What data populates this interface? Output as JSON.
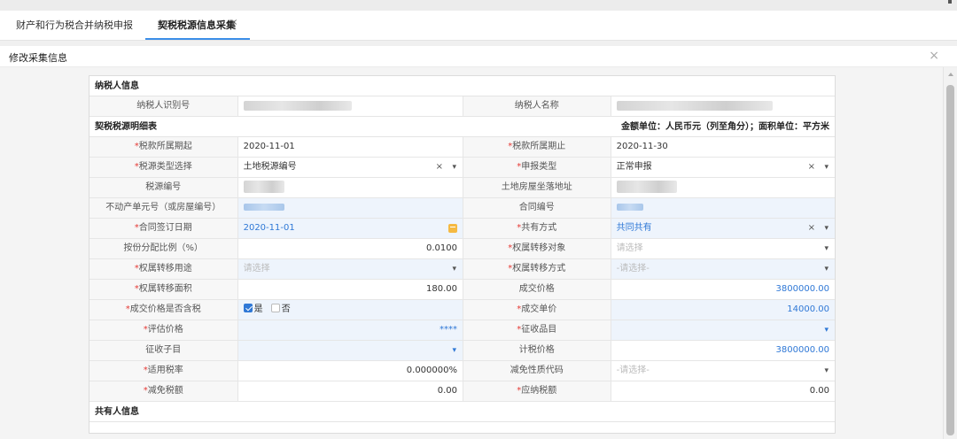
{
  "tabs": [
    {
      "label": "财产和行为税合并纳税申报"
    },
    {
      "label": "契税税源信息采集",
      "close": "×"
    }
  ],
  "subheader": {
    "title": "修改采集信息",
    "close": "×"
  },
  "form": {
    "section_taxpayer": "纳税人信息",
    "section_detail": "契税税源明细表",
    "unit_note": "金额单位：人民币元（列至角分）；面积单位：平方米",
    "section_coowner": "共有人信息",
    "taxpayer": {
      "id_label": "纳税人识别号",
      "name_label": "纳税人名称"
    },
    "period_start_label": "税款所属期起",
    "period_start": "2020-11-01",
    "period_end_label": "税款所属期止",
    "period_end": "2020-11-30",
    "source_type_label": "税源类型选择",
    "source_type": "土地税源编号",
    "declare_type_label": "申报类型",
    "declare_type": "正常申报",
    "source_no_label": "税源编号",
    "address_label": "土地房屋坐落地址",
    "unit_no_label": "不动产单元号（或房屋编号）",
    "contract_no_label": "合同编号",
    "sign_date_label": "合同签订日期",
    "sign_date": "2020-11-01",
    "joint_label": "共有方式",
    "joint": "共同共有",
    "ratio_label": "按份分配比例（%）",
    "ratio": "0.0100",
    "transfer_obj_label": "权属转移对象",
    "transfer_obj_ph": "请选择",
    "purpose_label": "权属转移用途",
    "purpose_ph": "请选择",
    "method_label": "权属转移方式",
    "method_ph": "-请选择-",
    "area_label": "权属转移面积",
    "area": "180.00",
    "price_label": "成交价格",
    "price": "3800000.00",
    "tax_incl_label": "成交价格是否含税",
    "yes": "是",
    "no": "否",
    "unit_price_label": "成交单价",
    "unit_price": "14000.00",
    "eval_label": "评估价格",
    "eval": "****",
    "item_label": "征收品目",
    "subitem_label": "征收子目",
    "tax_price_label": "计税价格",
    "tax_price": "3800000.00",
    "rate_label": "适用税率",
    "rate": "0.000000%",
    "exempt_code_label": "减免性质代码",
    "exempt_code_ph": "-请选择-",
    "relief_label": "减免税额",
    "relief": "0.00",
    "payable_label": "应纳税额",
    "payable": "0.00"
  },
  "symbols": {
    "req": "*",
    "clear": "×",
    "dropdown": "▾"
  },
  "colors": {
    "accent": "#3b8ee8",
    "link": "#2f78d6",
    "required": "#e53935",
    "highlight_bg": "#eef4fc"
  }
}
